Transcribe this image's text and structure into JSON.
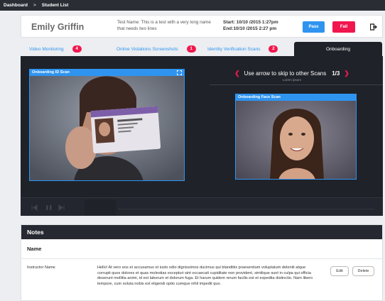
{
  "breadcrumb": {
    "root": "Dashboard",
    "separator": ">",
    "current": "Student List"
  },
  "header": {
    "student_name": "Emily Griffin",
    "test_name": "Test Name: This is a test with a very long name that needs two lines",
    "start": "Start: 10/10 /2015  1:27pm",
    "end": "End:10/10 /2015  2:27 pm",
    "pass_label": "Pass",
    "fail_label": "Fail"
  },
  "tabs": [
    {
      "label": "Video Monitoring",
      "badge": "4"
    },
    {
      "label": "Online Violations Screenshots",
      "badge": "1"
    },
    {
      "label": "Identity Verification Scans",
      "badge": "2"
    },
    {
      "label": "Onboarding",
      "badge": ""
    }
  ],
  "scans": {
    "id_title": "Onboarding ID Scan",
    "face_title": "Onboarding Face Scan",
    "nav_text": "Use arrow to skip to other Scans",
    "counter": "1/3",
    "caption": "Lorem ipsum"
  },
  "notes": {
    "title": "Notes",
    "column_header": "Name",
    "rows": [
      {
        "author": "Instructor Name",
        "text": "Hello! At vero eos et accusamus et iusto odio dignissimos ducimus qui blanditiis praesentium voluptatum deleniti atque corrupti quos dolores et quas molestias excepturi sint occaecati cupiditate non provident, similique sunt in culpa qui officia deserunt mollitia animi, id est laborum et dolorum fuga. Et harum quidem rerum facilis est et expedita distinctio. Nam libero tempore, cum soluta nobis est eligendi optio cumque nihil impedit quo.",
        "edit_label": "Edit",
        "delete_label": "Delete"
      }
    ]
  },
  "colors": {
    "accent": "#2f94f0",
    "danger": "#f1174e",
    "dark": "#1f2229"
  }
}
